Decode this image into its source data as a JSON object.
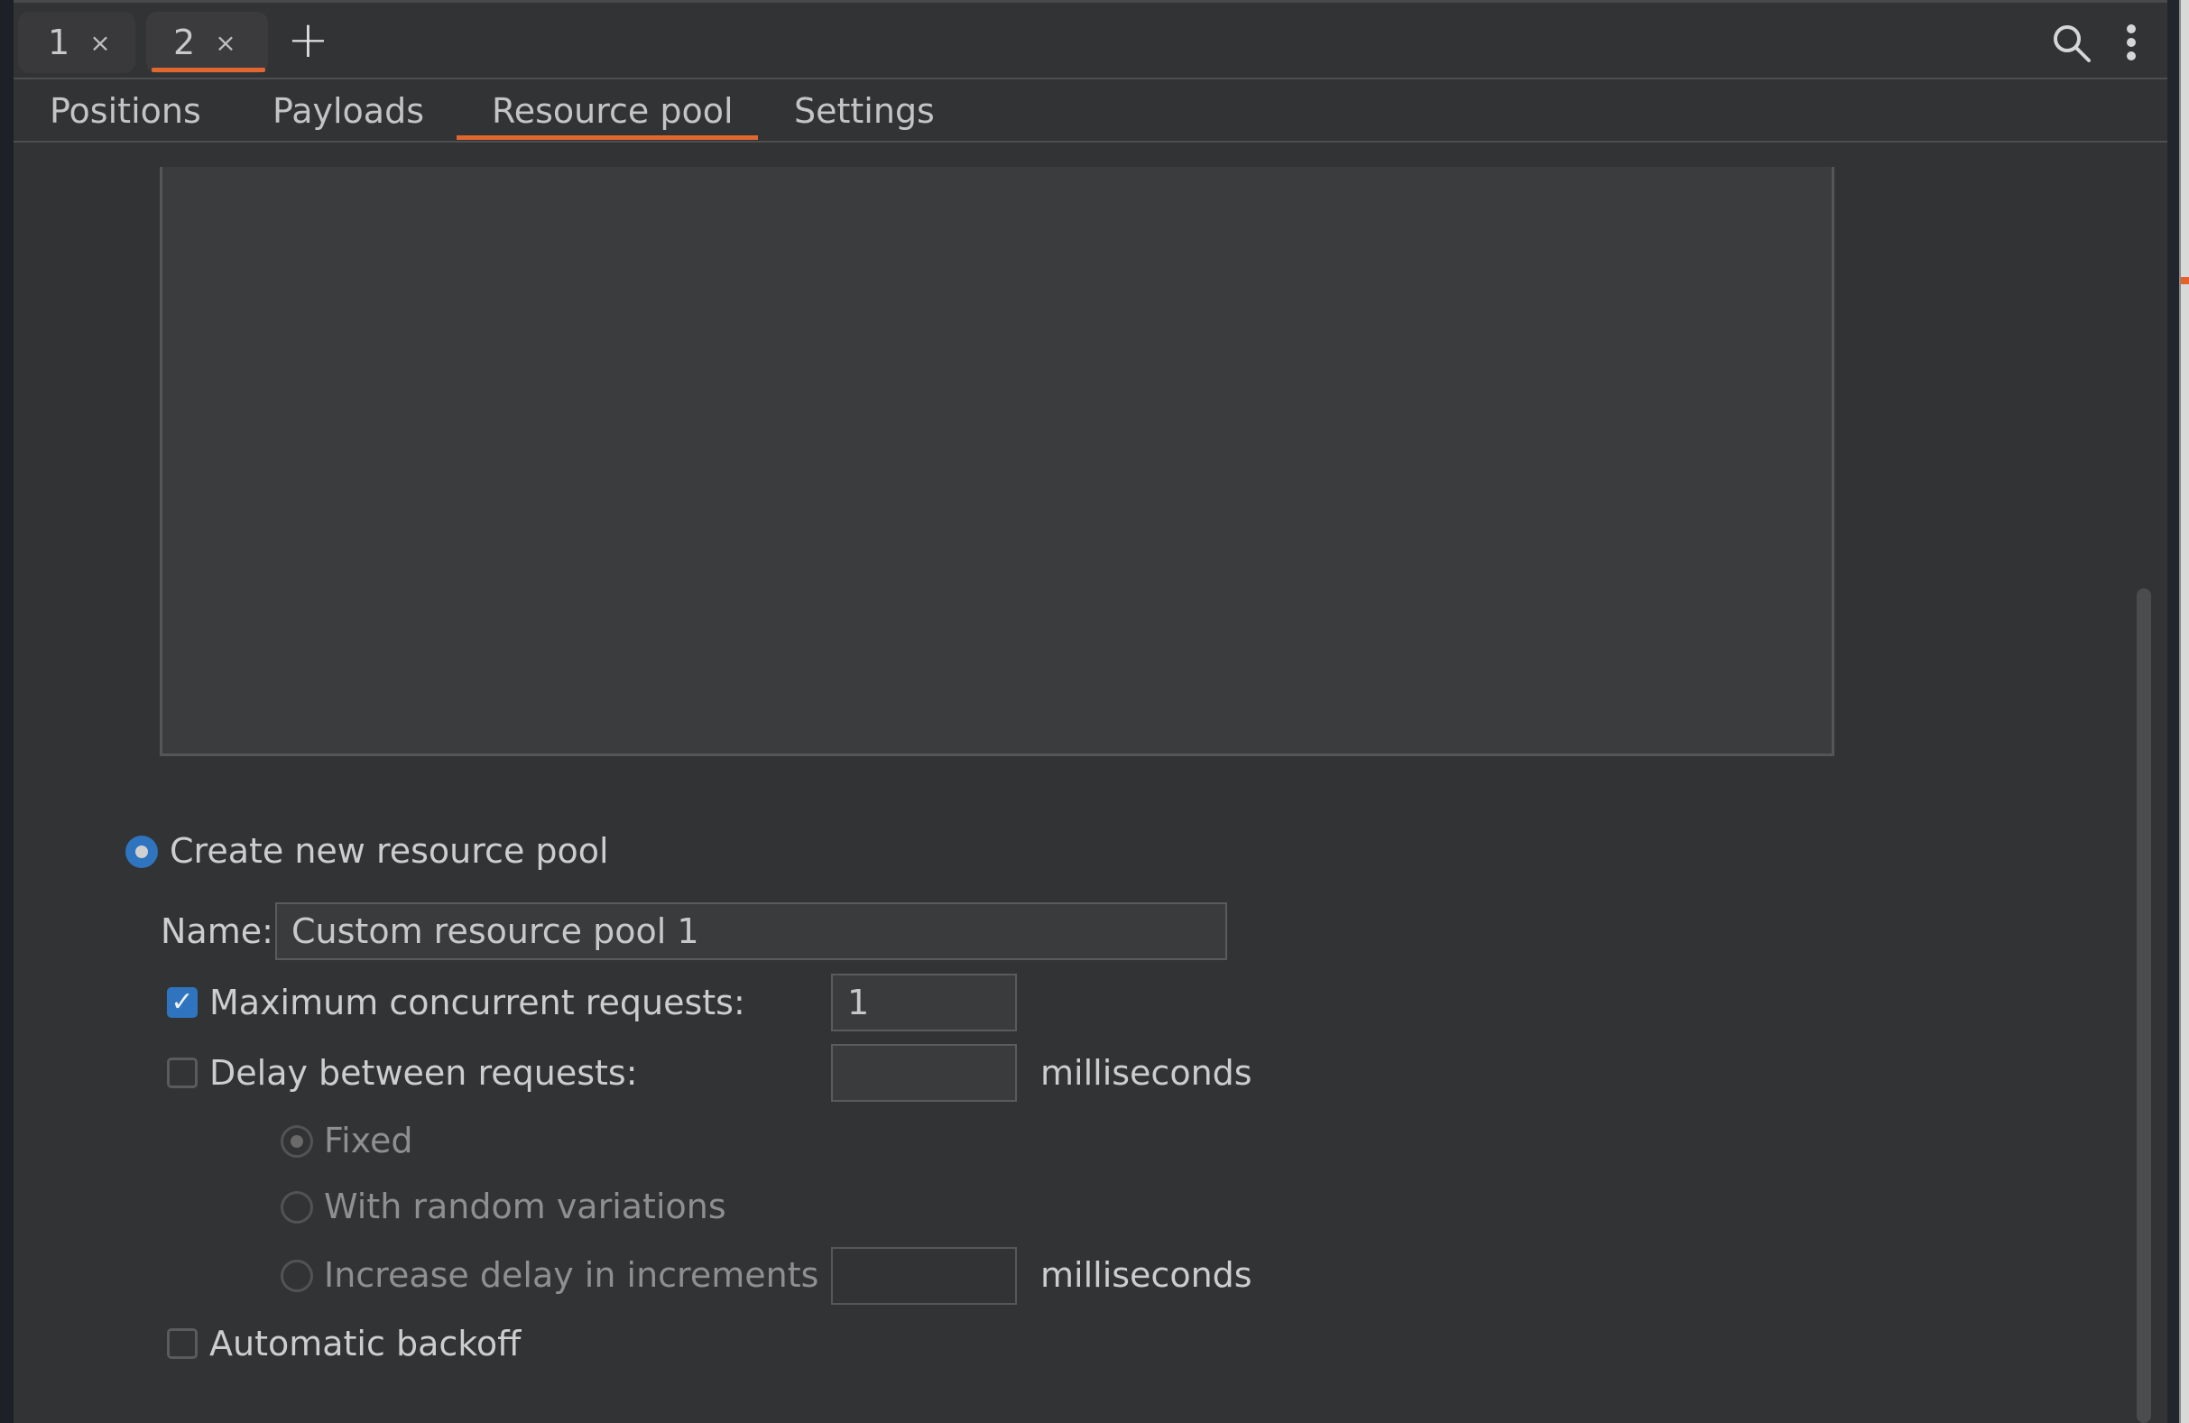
{
  "request_tabs": [
    {
      "label": "1",
      "close": "×",
      "active": false
    },
    {
      "label": "2",
      "close": "×",
      "active": true
    }
  ],
  "new_tab_label": "+",
  "toolbar": {
    "search_icon": "search-icon",
    "more_icon": "more-vertical-icon"
  },
  "sub_tabs": [
    {
      "label": "Positions",
      "active": false
    },
    {
      "label": "Payloads",
      "active": false
    },
    {
      "label": "Resource pool",
      "active": true
    },
    {
      "label": "Settings",
      "active": false
    }
  ],
  "resource_pool": {
    "create_new_label": "Create new resource pool",
    "create_new_selected": true,
    "name_label": "Name:",
    "name_value": "Custom resource pool 1",
    "max_concurrent": {
      "label": "Maximum concurrent requests:",
      "checked": true,
      "value": "1"
    },
    "delay_between": {
      "label": "Delay between requests:",
      "checked": false,
      "value": "",
      "unit": "milliseconds"
    },
    "delay_modes": [
      {
        "label": "Fixed",
        "selected": true
      },
      {
        "label": "With random variations",
        "selected": false
      },
      {
        "label": "Increase delay in increments of",
        "selected": false
      }
    ],
    "increment": {
      "value": "",
      "unit": "milliseconds"
    },
    "automatic_backoff": {
      "label": "Automatic backoff",
      "checked": false
    }
  },
  "colors": {
    "accent": "#e0672f",
    "selection": "#2f74be",
    "background": "#323335"
  }
}
